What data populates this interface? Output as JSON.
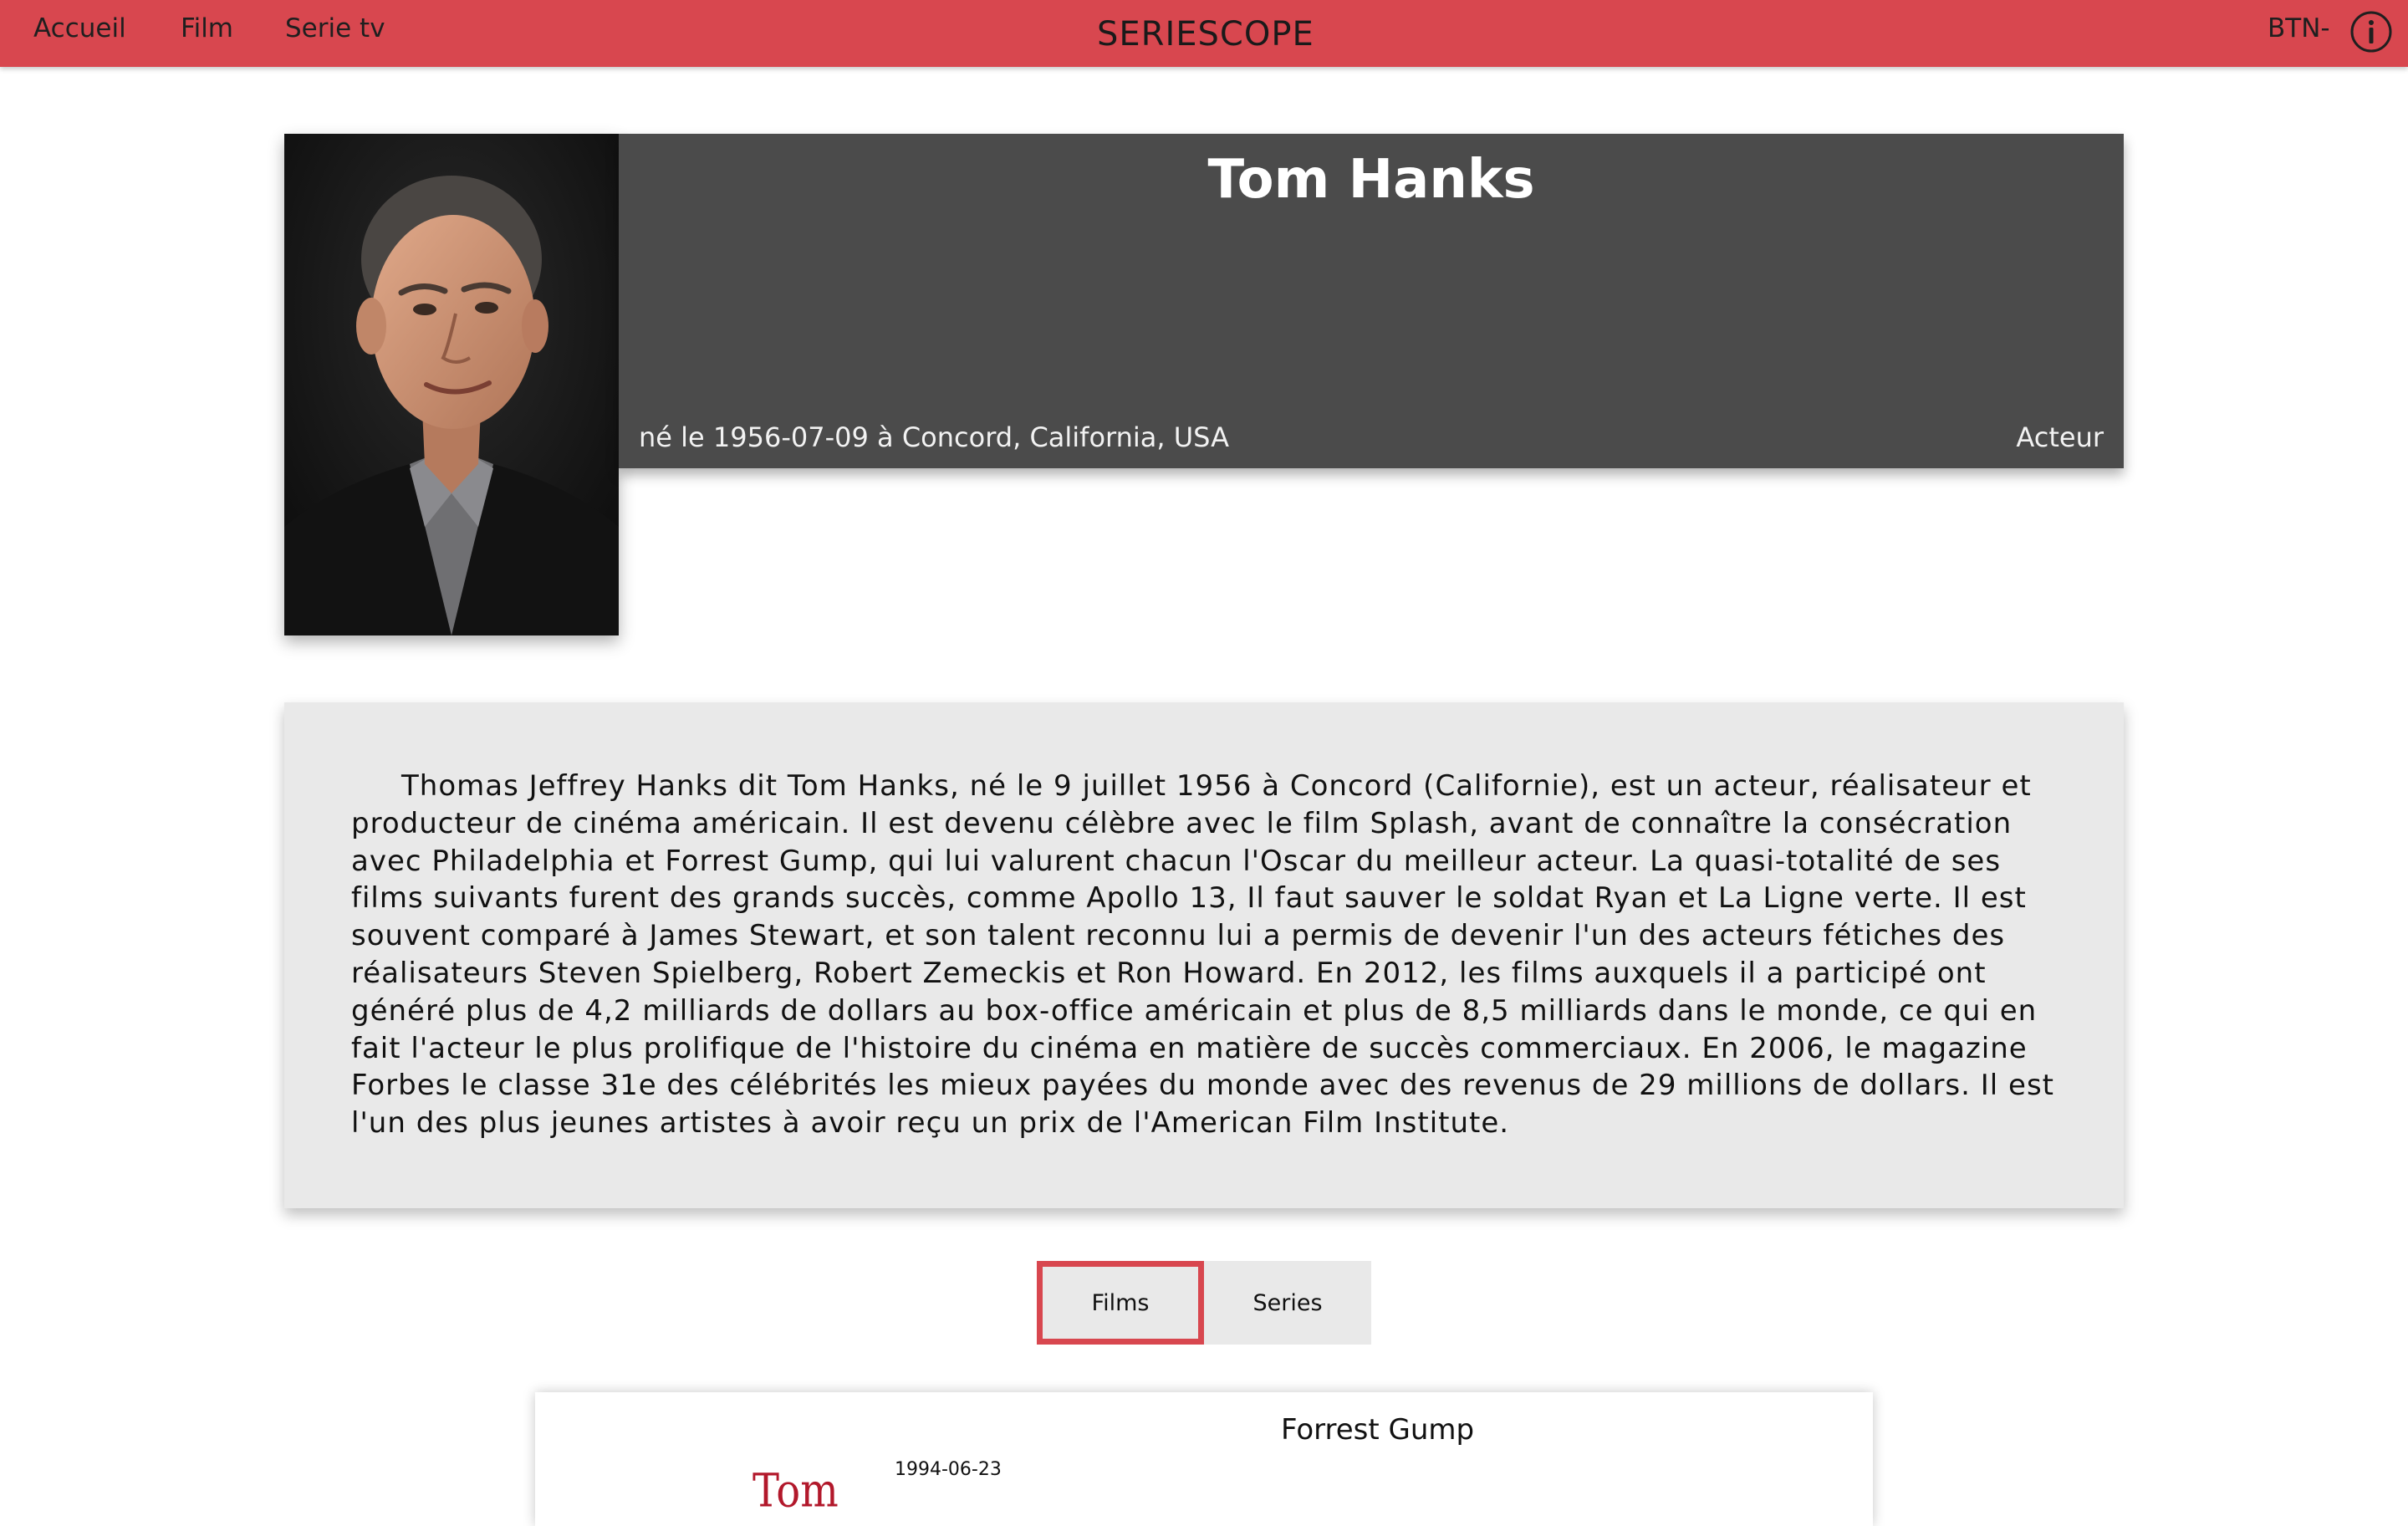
{
  "nav": {
    "links": [
      "Accueil",
      "Film",
      "Serie tv"
    ],
    "brand": "SERIESCOPE",
    "button_label": "BTN-",
    "info_icon": "info-circle-icon"
  },
  "person": {
    "name": "Tom Hanks",
    "birth": "né le 1956-07-09 à Concord, California, USA",
    "role": "Acteur",
    "photo_alt": "portrait"
  },
  "biography": "Thomas Jeffrey Hanks dit Tom Hanks, né le 9 juillet 1956 à Concord (Californie), est un acteur, réalisateur et producteur de cinéma américain. Il est devenu célèbre avec le film Splash, avant de connaître la consécration avec Philadelphia et Forrest Gump, qui lui valurent chacun l'Oscar du meilleur acteur. La quasi-totalité de ses films suivants furent des grands succès, comme Apollo 13, Il faut sauver le soldat Ryan et La Ligne verte. Il est souvent comparé à James Stewart, et son talent reconnu lui a permis de devenir l'un des acteurs fétiches des réalisateurs Steven Spielberg, Robert Zemeckis et Ron Howard. En 2012, les films auxquels il a participé ont généré plus de 4,2 milliards de dollars au box-office américain et plus de 8,5 milliards dans le monde, ce qui en fait l'acteur le plus prolifique de l'histoire du cinéma en matière de succès commerciaux. En 2006, le magazine Forbes le classe 31e des célébrités les mieux payées du monde avec des revenus de 29 millions de dollars. Il est l'un des plus jeunes artistes à avoir reçu un prix de l'American Film Institute.",
  "tabs": [
    {
      "label": "Films",
      "active": true
    },
    {
      "label": "Series",
      "active": false
    }
  ],
  "films": [
    {
      "title": "Forrest Gump",
      "date": "1994-06-23",
      "poster_text": "Tom"
    }
  ],
  "colors": {
    "accent": "#d8474f",
    "header_panel": "#4b4b4b",
    "card_bg": "#e9e9e9"
  }
}
